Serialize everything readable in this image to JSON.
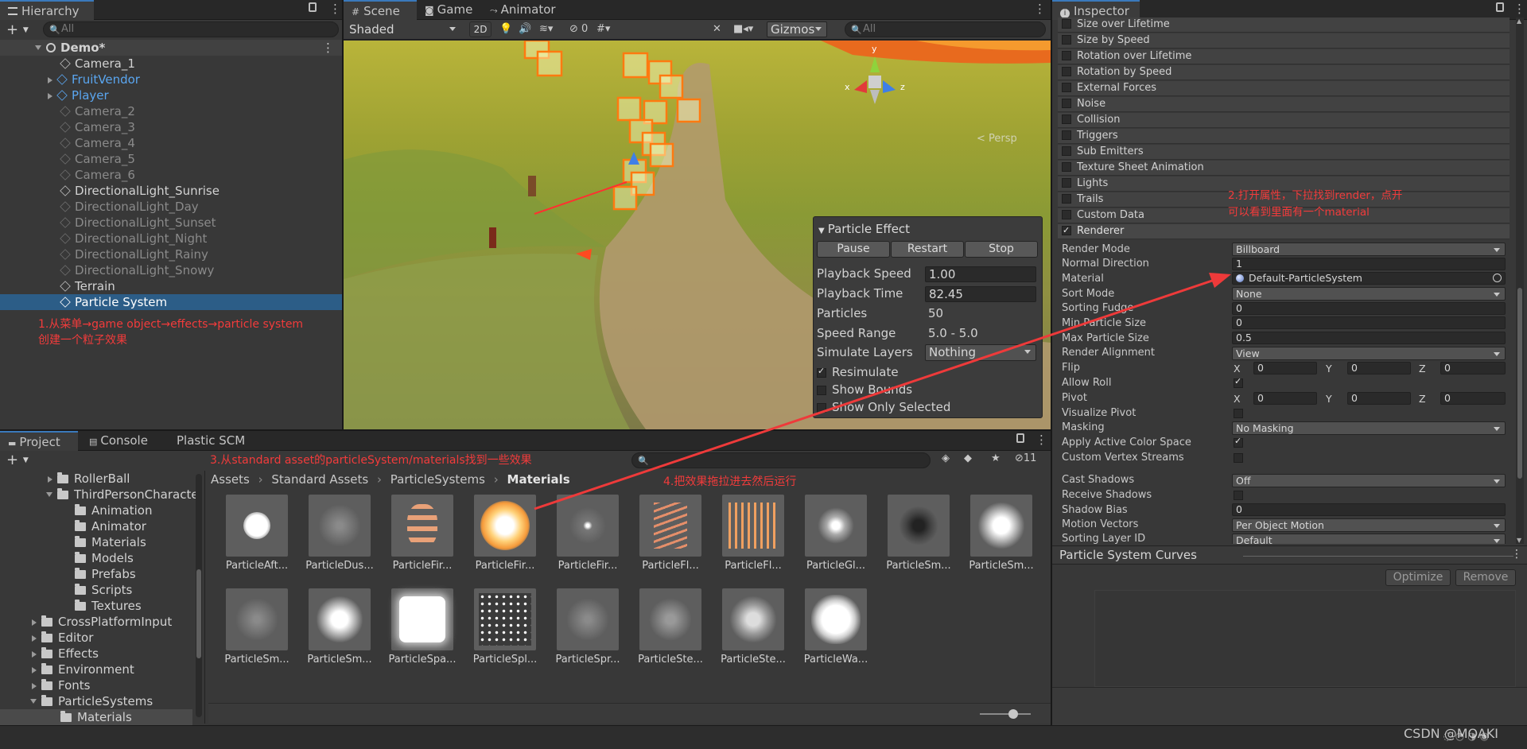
{
  "hierarchy": {
    "tab": "Hierarchy",
    "add": "+",
    "search_placeholder": "All",
    "scene": "Demo*",
    "items": [
      {
        "label": "Camera_1"
      },
      {
        "label": "FruitVendor"
      },
      {
        "label": "Player"
      },
      {
        "label": "Camera_2"
      },
      {
        "label": "Camera_3"
      },
      {
        "label": "Camera_4"
      },
      {
        "label": "Camera_5"
      },
      {
        "label": "Camera_6"
      },
      {
        "label": "DirectionalLight_Sunrise"
      },
      {
        "label": "DirectionalLight_Day"
      },
      {
        "label": "DirectionalLight_Sunset"
      },
      {
        "label": "DirectionalLight_Night"
      },
      {
        "label": "DirectionalLight_Rainy"
      },
      {
        "label": "DirectionalLight_Snowy"
      },
      {
        "label": "Terrain"
      },
      {
        "label": "Particle System"
      }
    ],
    "note1_line1": "1.从菜单→game object→effects→particle system",
    "note1_line2": "创建一个粒子效果"
  },
  "scene_view": {
    "tabs": [
      "Scene",
      "Game",
      "Animator"
    ],
    "shading": "Shaded",
    "mode_2d": "2D",
    "hidden_count": "0",
    "gizmos": "Gizmos",
    "search_placeholder": "All",
    "persp": "< Persp",
    "axis_x": "x",
    "axis_y": "y",
    "axis_z": "z"
  },
  "particle_effect": {
    "title": "Particle Effect",
    "pause": "Pause",
    "restart": "Restart",
    "stop": "Stop",
    "rows": [
      {
        "label": "Playback Speed",
        "value": "1.00"
      },
      {
        "label": "Playback Time",
        "value": "82.45"
      },
      {
        "label": "Particles",
        "value": "50"
      },
      {
        "label": "Speed Range",
        "value": "5.0 - 5.0"
      },
      {
        "label": "Simulate Layers",
        "value": "Nothing"
      }
    ],
    "resimulate": "Resimulate",
    "show_bounds": "Show Bounds",
    "show_only_selected": "Show Only Selected"
  },
  "project": {
    "tabs": [
      "Project",
      "Console",
      "Plastic SCM"
    ],
    "add": "+",
    "hidden_count": "11",
    "note3": "3.从standard asset的particleSystem/materials找到一些效果",
    "note4": "4.把效果拖拉进去然后运行",
    "breadcrumb": [
      "Assets",
      "Standard Assets",
      "ParticleSystems",
      "Materials"
    ],
    "tree": [
      {
        "label": "RollerBall"
      },
      {
        "label": "ThirdPersonCharacte"
      },
      {
        "label": "Animation"
      },
      {
        "label": "Animator"
      },
      {
        "label": "Materials"
      },
      {
        "label": "Models"
      },
      {
        "label": "Prefabs"
      },
      {
        "label": "Scripts"
      },
      {
        "label": "Textures"
      },
      {
        "label": "CrossPlatformInput"
      },
      {
        "label": "Editor"
      },
      {
        "label": "Effects"
      },
      {
        "label": "Environment"
      },
      {
        "label": "Fonts"
      },
      {
        "label": "ParticleSystems"
      },
      {
        "label": "Materials"
      }
    ],
    "assets": [
      {
        "label": "ParticleAft..."
      },
      {
        "label": "ParticleDus..."
      },
      {
        "label": "ParticleFir..."
      },
      {
        "label": "ParticleFir..."
      },
      {
        "label": "ParticleFir..."
      },
      {
        "label": "ParticleFl..."
      },
      {
        "label": "ParticleFl..."
      },
      {
        "label": "ParticleGl..."
      },
      {
        "label": "ParticleSm..."
      },
      {
        "label": "ParticleSm..."
      },
      {
        "label": "ParticleSm..."
      },
      {
        "label": "ParticleSm..."
      },
      {
        "label": "ParticleSpa..."
      },
      {
        "label": "ParticleSpl..."
      },
      {
        "label": "ParticleSpr..."
      },
      {
        "label": "ParticleSte..."
      },
      {
        "label": "ParticleSte..."
      },
      {
        "label": "ParticleWa..."
      }
    ]
  },
  "inspector": {
    "tab": "Inspector",
    "modules": [
      {
        "label": "Size over Lifetime"
      },
      {
        "label": "Size by Speed"
      },
      {
        "label": "Rotation over Lifetime"
      },
      {
        "label": "Rotation by Speed"
      },
      {
        "label": "External Forces"
      },
      {
        "label": "Noise"
      },
      {
        "label": "Collision"
      },
      {
        "label": "Triggers"
      },
      {
        "label": "Sub Emitters"
      },
      {
        "label": "Texture Sheet Animation"
      },
      {
        "label": "Lights"
      },
      {
        "label": "Trails"
      },
      {
        "label": "Custom Data"
      },
      {
        "label": "Renderer"
      }
    ],
    "note2_line1": "2.打开属性，下拉找到render，点开",
    "note2_line2": "可以看到里面有一个material",
    "props": {
      "render_mode": {
        "label": "Render Mode",
        "value": "Billboard"
      },
      "normal_direction": {
        "label": "Normal Direction",
        "value": "1"
      },
      "material": {
        "label": "Material",
        "value": "Default-ParticleSystem"
      },
      "sort_mode": {
        "label": "Sort Mode",
        "value": "None"
      },
      "sorting_fudge": {
        "label": "Sorting Fudge",
        "value": "0"
      },
      "min_particle_size": {
        "label": "Min Particle Size",
        "value": "0"
      },
      "max_particle_size": {
        "label": "Max Particle Size",
        "value": "0.5"
      },
      "render_alignment": {
        "label": "Render Alignment",
        "value": "View"
      },
      "flip": {
        "label": "Flip",
        "x": "0",
        "y": "0",
        "z": "0"
      },
      "allow_roll": {
        "label": "Allow Roll"
      },
      "pivot": {
        "label": "Pivot",
        "x": "0",
        "y": "0",
        "z": "0"
      },
      "visualize_pivot": {
        "label": "Visualize Pivot"
      },
      "masking": {
        "label": "Masking",
        "value": "No Masking"
      },
      "apply_active_color_space": {
        "label": "Apply Active Color Space"
      },
      "custom_vertex_streams": {
        "label": "Custom Vertex Streams"
      },
      "cast_shadows": {
        "label": "Cast Shadows",
        "value": "Off"
      },
      "receive_shadows": {
        "label": "Receive Shadows"
      },
      "shadow_bias": {
        "label": "Shadow Bias",
        "value": "0"
      },
      "motion_vectors": {
        "label": "Motion Vectors",
        "value": "Per Object Motion"
      },
      "sorting_layer_id": {
        "label": "Sorting Layer ID",
        "value": "Default"
      }
    },
    "axis_x": "X",
    "axis_y": "Y",
    "axis_z": "Z",
    "curves_title": "Particle System Curves",
    "optimize": "Optimize",
    "remove": "Remove"
  },
  "watermark": "CSDN @MOAKI"
}
